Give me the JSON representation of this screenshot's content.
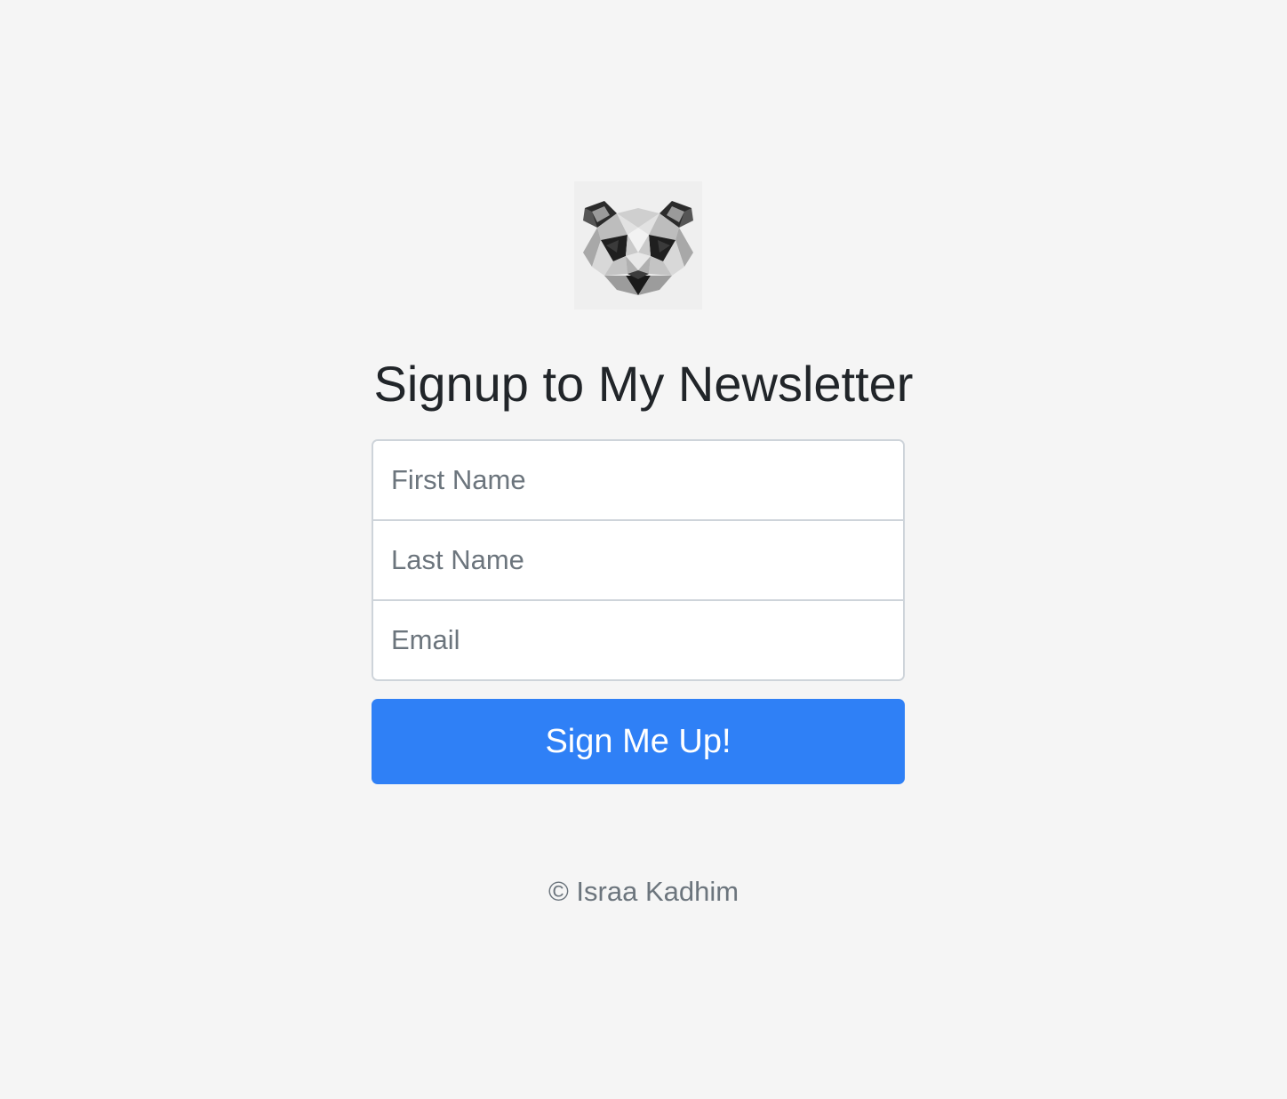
{
  "logo": {
    "icon": "raccoon-logo-icon",
    "alt": "low-poly raccoon head"
  },
  "title": "Signup to My Newsletter",
  "form": {
    "first_name_placeholder": "First Name",
    "last_name_placeholder": "Last Name",
    "email_placeholder": "Email"
  },
  "submit_label": "Sign Me Up!",
  "footer": "© Israa Kadhim",
  "colors": {
    "background": "#f5f5f5",
    "primary_button": "#2f80f6",
    "title_text": "#212529",
    "muted_text": "#6c757d",
    "input_border": "#ced4da"
  }
}
